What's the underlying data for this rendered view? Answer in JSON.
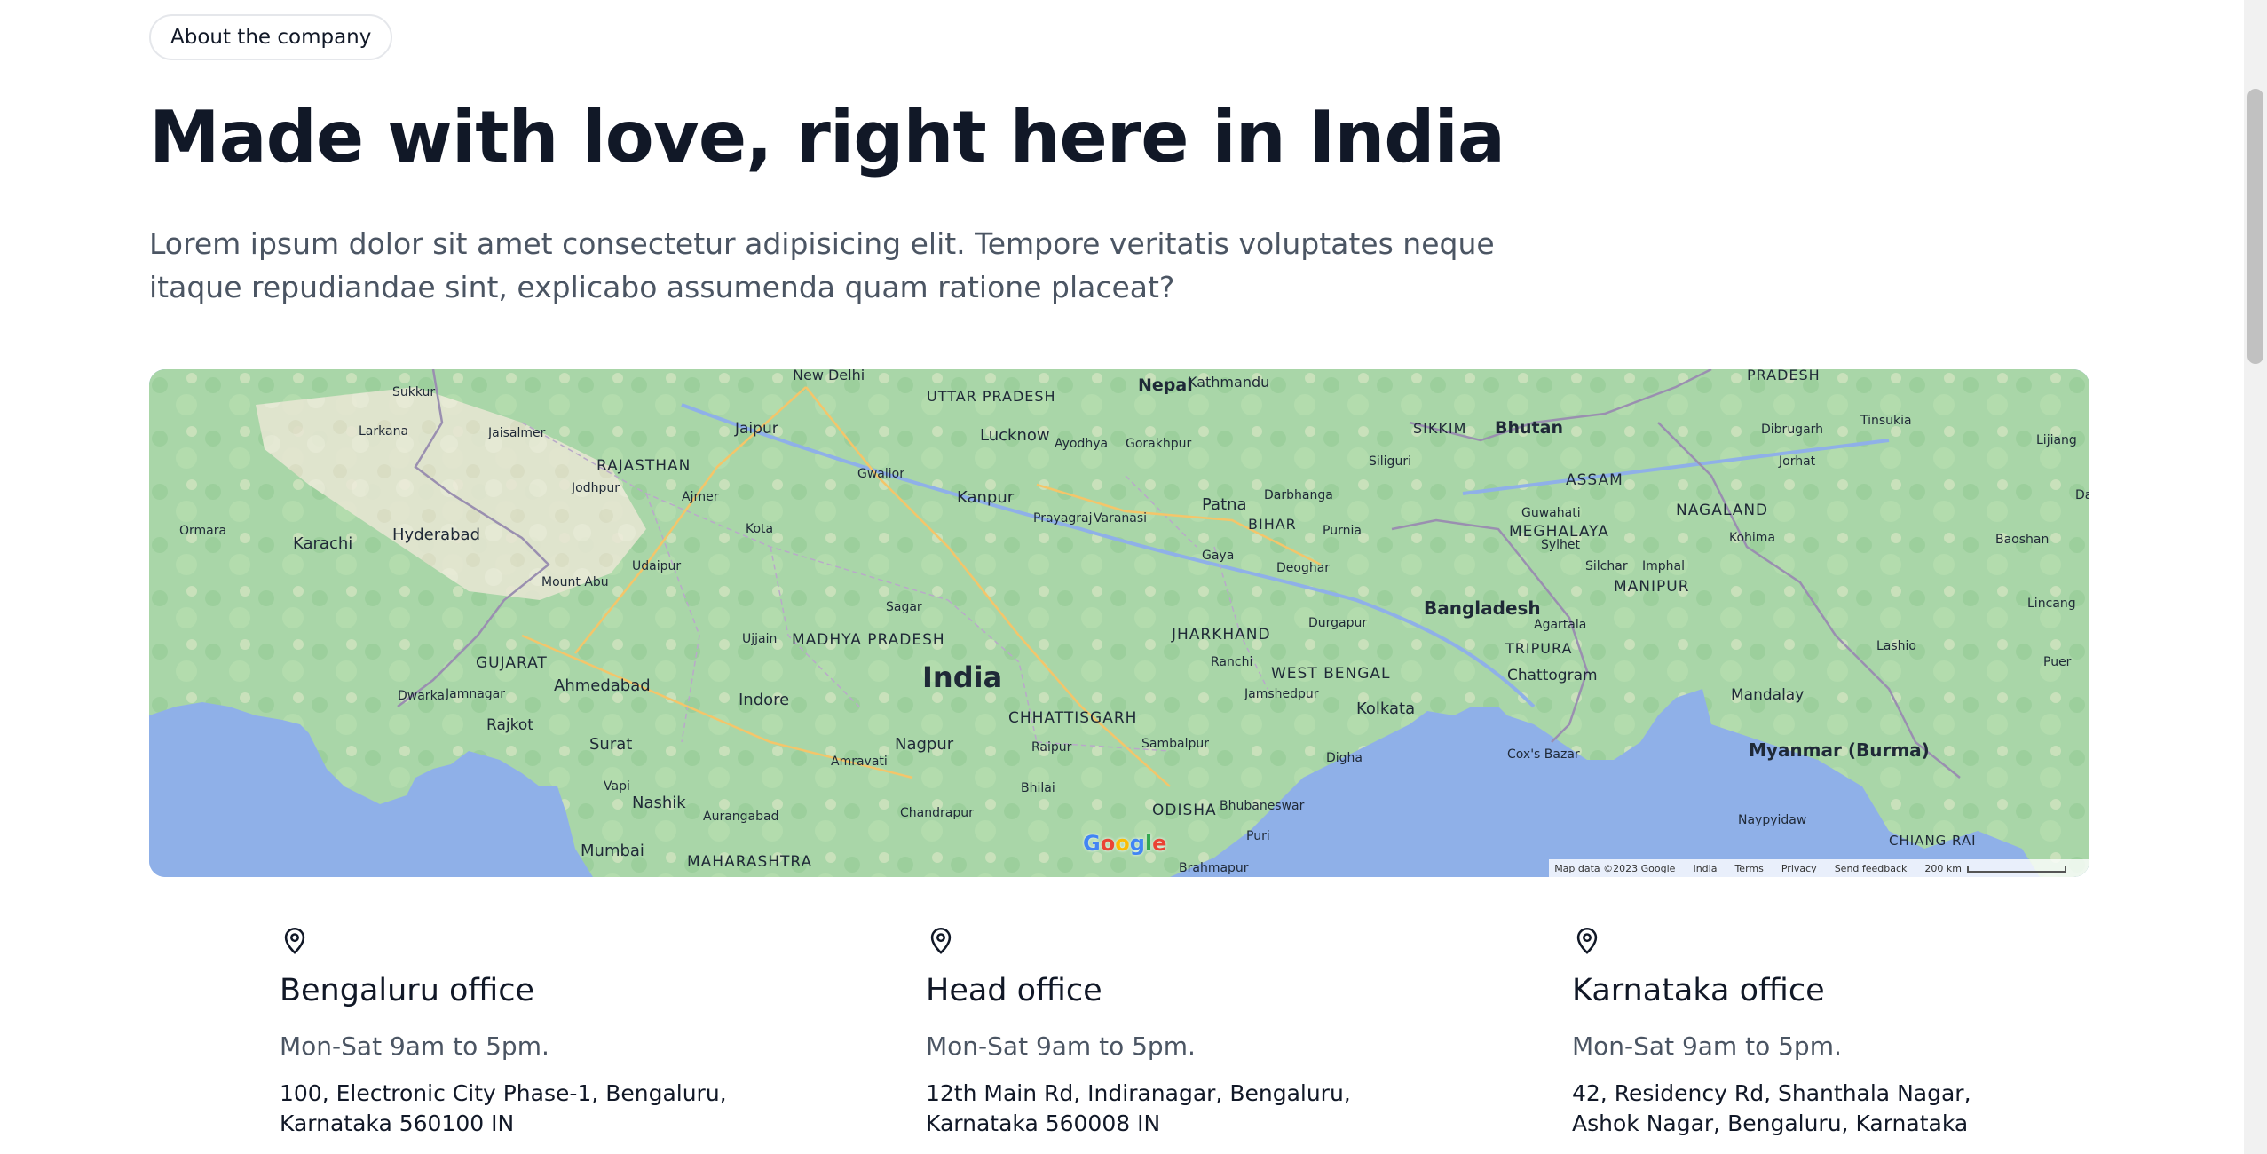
{
  "badge": {
    "label": "About the company"
  },
  "hero": {
    "title": "Made with love, right here in India",
    "lead": "Lorem ipsum dolor sit amet consectetur adipisicing elit. Tempore veritatis voluptates neque itaque repudiandae sint, explicabo assumenda quam ratione placeat?"
  },
  "map": {
    "country_label": "India",
    "labels": {
      "new_delhi": "New Delhi",
      "jaipur": "Jaipur",
      "lucknow": "Lucknow",
      "kanpur": "Kanpur",
      "patna": "Patna",
      "nepal": "Nepal",
      "kathmandu": "Kathmandu",
      "bhutan": "Bhutan",
      "bangladesh": "Bangladesh",
      "kolkata": "Kolkata",
      "hyderabad": "Hyderabad",
      "karachi": "Karachi",
      "ahmedabad": "Ahmedabad",
      "surat": "Surat",
      "mumbai": "Mumbai",
      "nashik": "Nashik",
      "nagpur": "Nagpur",
      "indore": "Indore",
      "rajasthan": "RAJASTHAN",
      "gujarat": "GUJARAT",
      "madhya_pradesh": "MADHYA PRADESH",
      "maharashtra": "MAHARASHTRA",
      "chhattisgarh": "CHHATTISGARH",
      "jharkhand": "JHARKHAND",
      "west_bengal": "WEST BENGAL",
      "odisha": "ODISHA",
      "uttar_pradesh": "UTTAR PRADESH",
      "bihar": "BIHAR",
      "assam": "ASSAM",
      "nagaland": "NAGALAND",
      "meghalaya": "MEGHALAYA",
      "manipur": "MANIPUR",
      "tripura": "TRIPURA",
      "sikkim": "SIKKIM",
      "myanmar": "Myanmar (Burma)",
      "mandalay": "Mandalay",
      "chattogram": "Chattogram",
      "guwahati": "Guwahati",
      "rajkot": "Rajkot",
      "gwalior": "Gwalior",
      "kota": "Kota",
      "sagar": "Sagar",
      "raipur": "Raipur",
      "ranchi": "Ranchi",
      "gaya": "Gaya",
      "varanasi": "Varanasi",
      "prayagraj": "Prayagraj",
      "amravati": "Amravati",
      "aurangabad": "Aurangabad",
      "bhubaneswar": "Bhubaneswar",
      "ajmer": "Ajmer",
      "jodhpur": "Jodhpur",
      "udaipur": "Udaipur",
      "ujjain": "Ujjain",
      "dibrugarh": "Dibrugarh",
      "imphal": "Imphal",
      "agartala": "Agartala",
      "durgapur": "Durgapur",
      "sambalpur": "Sambalpur",
      "jamshedpur": "Jamshedpur",
      "deoghar": "Deoghar",
      "darbhanga": "Darbhanga",
      "purnia": "Purnia",
      "gorakhpur": "Gorakhpur",
      "ayodhya": "Ayodhya",
      "siliguri": "Siliguri",
      "sylhet": "Sylhet",
      "silchar": "Silchar",
      "coxs_bazar": "Cox's Bazar",
      "digha": "Digha",
      "puri": "Puri",
      "brahmapur": "Brahmapur",
      "chandrapur": "Chandrapur",
      "bhilai": "Bhilai",
      "vapi": "Vapi",
      "dwarka": "Dwarka",
      "jamnagar": "Jamnagar",
      "mount_abu": "Mount Abu",
      "jaisalmer": "Jaisalmer",
      "sukkur": "Sukkur",
      "larkana": "Larkana",
      "ormara": "Ormara",
      "tinsukia": "Tinsukia",
      "jorhat": "Jorhat",
      "kohima": "Kohima",
      "lijiang": "Lijiang",
      "dali": "Dali",
      "baoshan": "Baoshan",
      "lincang": "Lincang",
      "puer": "Puer",
      "lashio": "Lashio",
      "naypyidaw": "Naypyidaw",
      "pradesh_ne": "PRADESH",
      "chiang_rai": "CHIANG RAI"
    },
    "footer": {
      "map_data": "Map data ©2023 Google",
      "region": "India",
      "terms": "Terms",
      "privacy": "Privacy",
      "feedback": "Send feedback",
      "scale": "200 km"
    },
    "google_letters": [
      "G",
      "o",
      "o",
      "g",
      "l",
      "e"
    ]
  },
  "offices": [
    {
      "name": "Bengaluru office",
      "hours": "Mon-Sat 9am to 5pm.",
      "address_line1": "100, Electronic City Phase-1, Bengaluru,",
      "address_line2": "Karnataka 560100 IN"
    },
    {
      "name": "Head office",
      "hours": "Mon-Sat 9am to 5pm.",
      "address_line1": "12th Main Rd, Indiranagar, Bengaluru,",
      "address_line2": "Karnataka 560008 IN"
    },
    {
      "name": "Karnataka office",
      "hours": "Mon-Sat 9am to 5pm.",
      "address_line1": "42, Residency Rd, Shanthala Nagar,",
      "address_line2": "Ashok Nagar, Bengaluru, Karnataka"
    }
  ],
  "colors": {
    "heading": "#111827",
    "muted_text": "#4b5563",
    "land": "#9fd3a3",
    "water": "#8fb0e8",
    "border": "#e5e7eb"
  }
}
